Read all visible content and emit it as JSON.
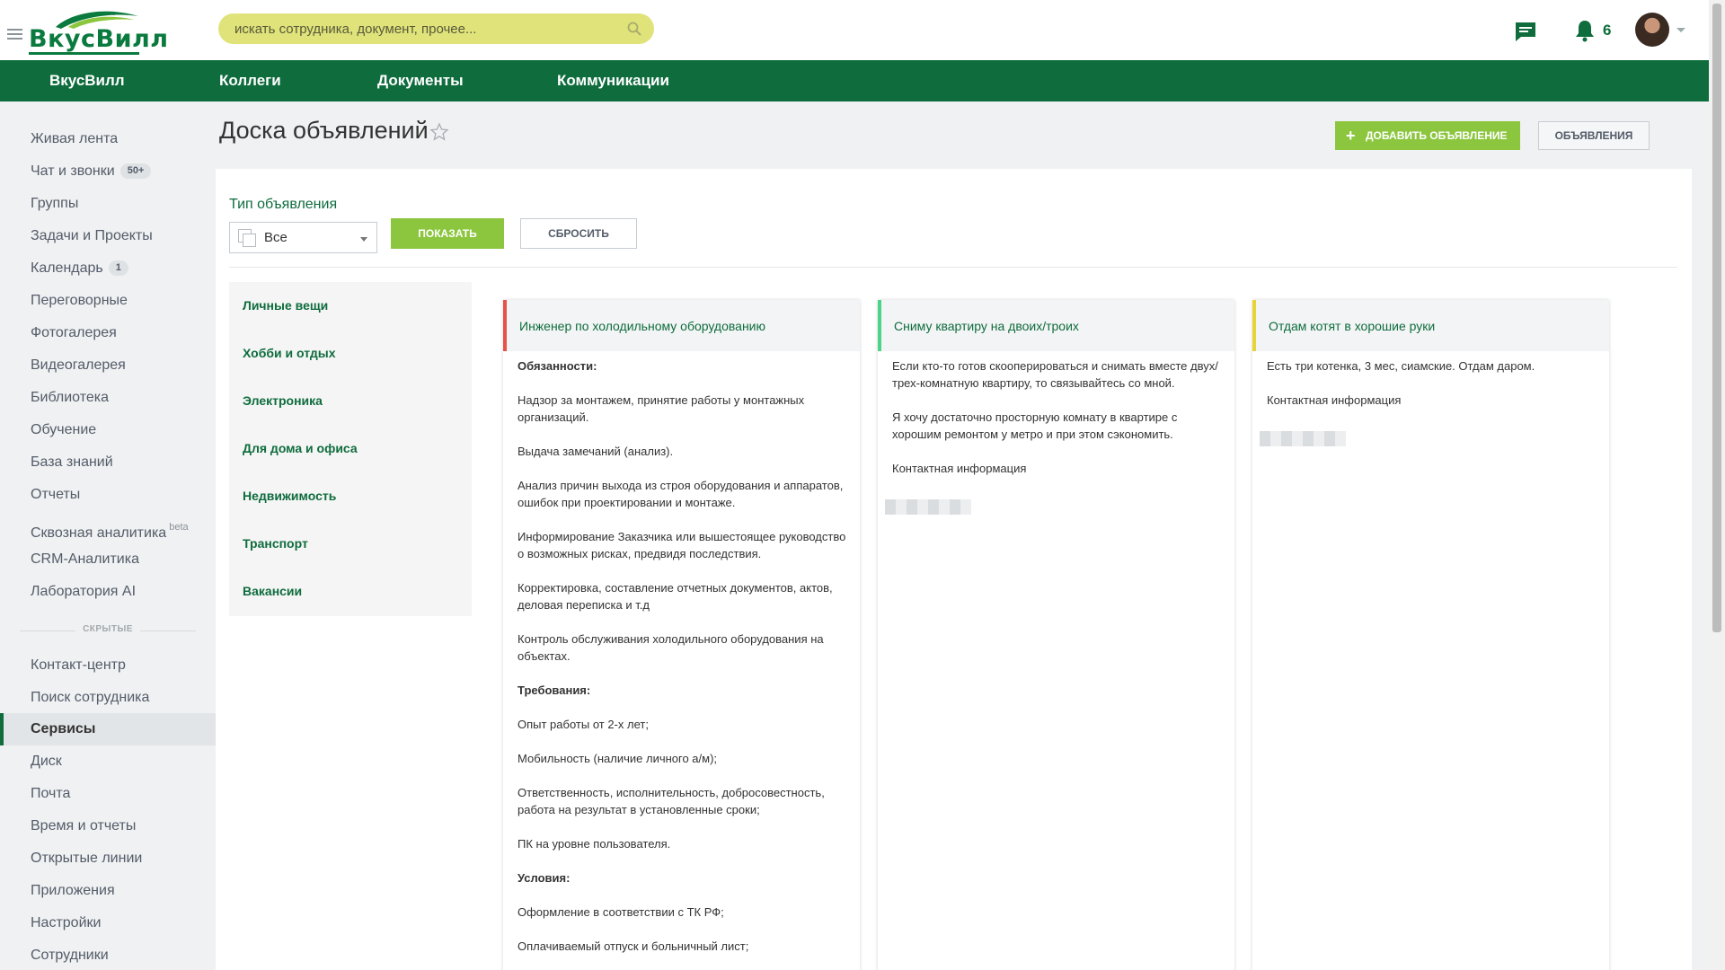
{
  "logo": {
    "text": "ВкусВилл"
  },
  "search": {
    "placeholder": "искать сотрудника, документ, прочее..."
  },
  "notifications": {
    "count": "6"
  },
  "nav": [
    "ВкусВилл",
    "Коллеги",
    "Документы",
    "Коммуникации"
  ],
  "sidebar": {
    "items": [
      {
        "label": "Живая лента"
      },
      {
        "label": "Чат и звонки",
        "badge": "50+"
      },
      {
        "label": "Группы"
      },
      {
        "label": "Задачи и Проекты"
      },
      {
        "label": "Календарь",
        "badge": "1"
      },
      {
        "label": "Переговорные"
      },
      {
        "label": "Фотогалерея"
      },
      {
        "label": "Видеогалерея"
      },
      {
        "label": "Библиотека"
      },
      {
        "label": "Обучение"
      },
      {
        "label": "База знаний"
      },
      {
        "label": "Отчеты"
      },
      {
        "label": "Сквозная аналитика",
        "sup": "beta"
      },
      {
        "label": "CRM-Аналитика"
      },
      {
        "label": "Лаборатория AI"
      }
    ],
    "separator": "СКРЫТЫЕ",
    "hidden_items": [
      {
        "label": "Контакт-центр"
      },
      {
        "label": "Поиск сотрудника"
      },
      {
        "label": "Сервисы",
        "active": true
      },
      {
        "label": "Диск"
      },
      {
        "label": "Почта"
      },
      {
        "label": "Время и отчеты"
      },
      {
        "label": "Открытые линии"
      },
      {
        "label": "Приложения"
      },
      {
        "label": "Настройки"
      },
      {
        "label": "Сотрудники"
      }
    ]
  },
  "page": {
    "title": "Доска объявлений",
    "add_button": "ДОБАВИТЬ ОБЪЯВЛЕНИЕ",
    "ads_button": "ОБЪЯВЛЕНИЯ"
  },
  "filter": {
    "label": "Тип объявления",
    "selected": "Все",
    "show_button": "ПОКАЗАТЬ",
    "reset_button": "СБРОСИТЬ"
  },
  "categories": [
    "Личные вещи",
    "Хобби и отдых",
    "Электроника",
    "Для дома и офиса",
    "Недвижимость",
    "Транспорт",
    "Вакансии"
  ],
  "cards": [
    {
      "title": "Инженер по холодильному оборудованию",
      "accent": "#e8504a",
      "body": [
        {
          "text": "Обязанности:",
          "bold": true
        },
        {
          "text": "Надзор за монтажем, принятие работы у монтажных организаций."
        },
        {
          "text": "Выдача замечаний (анализ)."
        },
        {
          "text": "Анализ причин выхода из строя оборудования и аппаратов, ошибок при проектировании и монтаже."
        },
        {
          "text": "Информирование Заказчика или вышестоящее руководство о возможных рисках, предвидя последствия."
        },
        {
          "text": "Корректировка, составление отчетных документов, актов, деловая переписка и т.д"
        },
        {
          "text": "Контроль обслуживания холодильного оборудования на объектах."
        },
        {
          "text": "Требования:",
          "bold": true
        },
        {
          "text": "Опыт работы от 2-х лет;"
        },
        {
          "text": "Мобильность (наличие личного а/м);"
        },
        {
          "text": "Ответственность, исполнительность, добросовестность, работа на результат в установленные сроки;"
        },
        {
          "text": "ПК на уровне пользователя."
        },
        {
          "text": "Условия:",
          "bold": true
        },
        {
          "text": "Оформление в соответствии с ТК РФ;"
        },
        {
          "text": "Оплачиваемый отпуск и больничный лист;"
        }
      ]
    },
    {
      "title": "Сниму квартиру на двоих/троих",
      "accent": "#4cd48a",
      "body": [
        {
          "text": "Если кто-то готов скооперироваться и снимать вместе двух/трех-комнатную квартиру, то связывайтесь со мной."
        },
        {
          "text": "Я хочу достаточно просторную комнату в квартире с хорошим ремонтом у метро и при этом сэкономить."
        },
        {
          "text": "Контактная информация"
        }
      ]
    },
    {
      "title": "Отдам котят в хорошие руки",
      "accent": "#e6d43a",
      "body": [
        {
          "text": "Есть три котенка, 3 мес, сиамские. Отдам даром."
        },
        {
          "text": "Контактная информация"
        }
      ]
    }
  ],
  "colors": {
    "brand_green": "#0e6c3d",
    "accent_lime": "#8cc63f",
    "search_bg": "#dfe37a"
  }
}
